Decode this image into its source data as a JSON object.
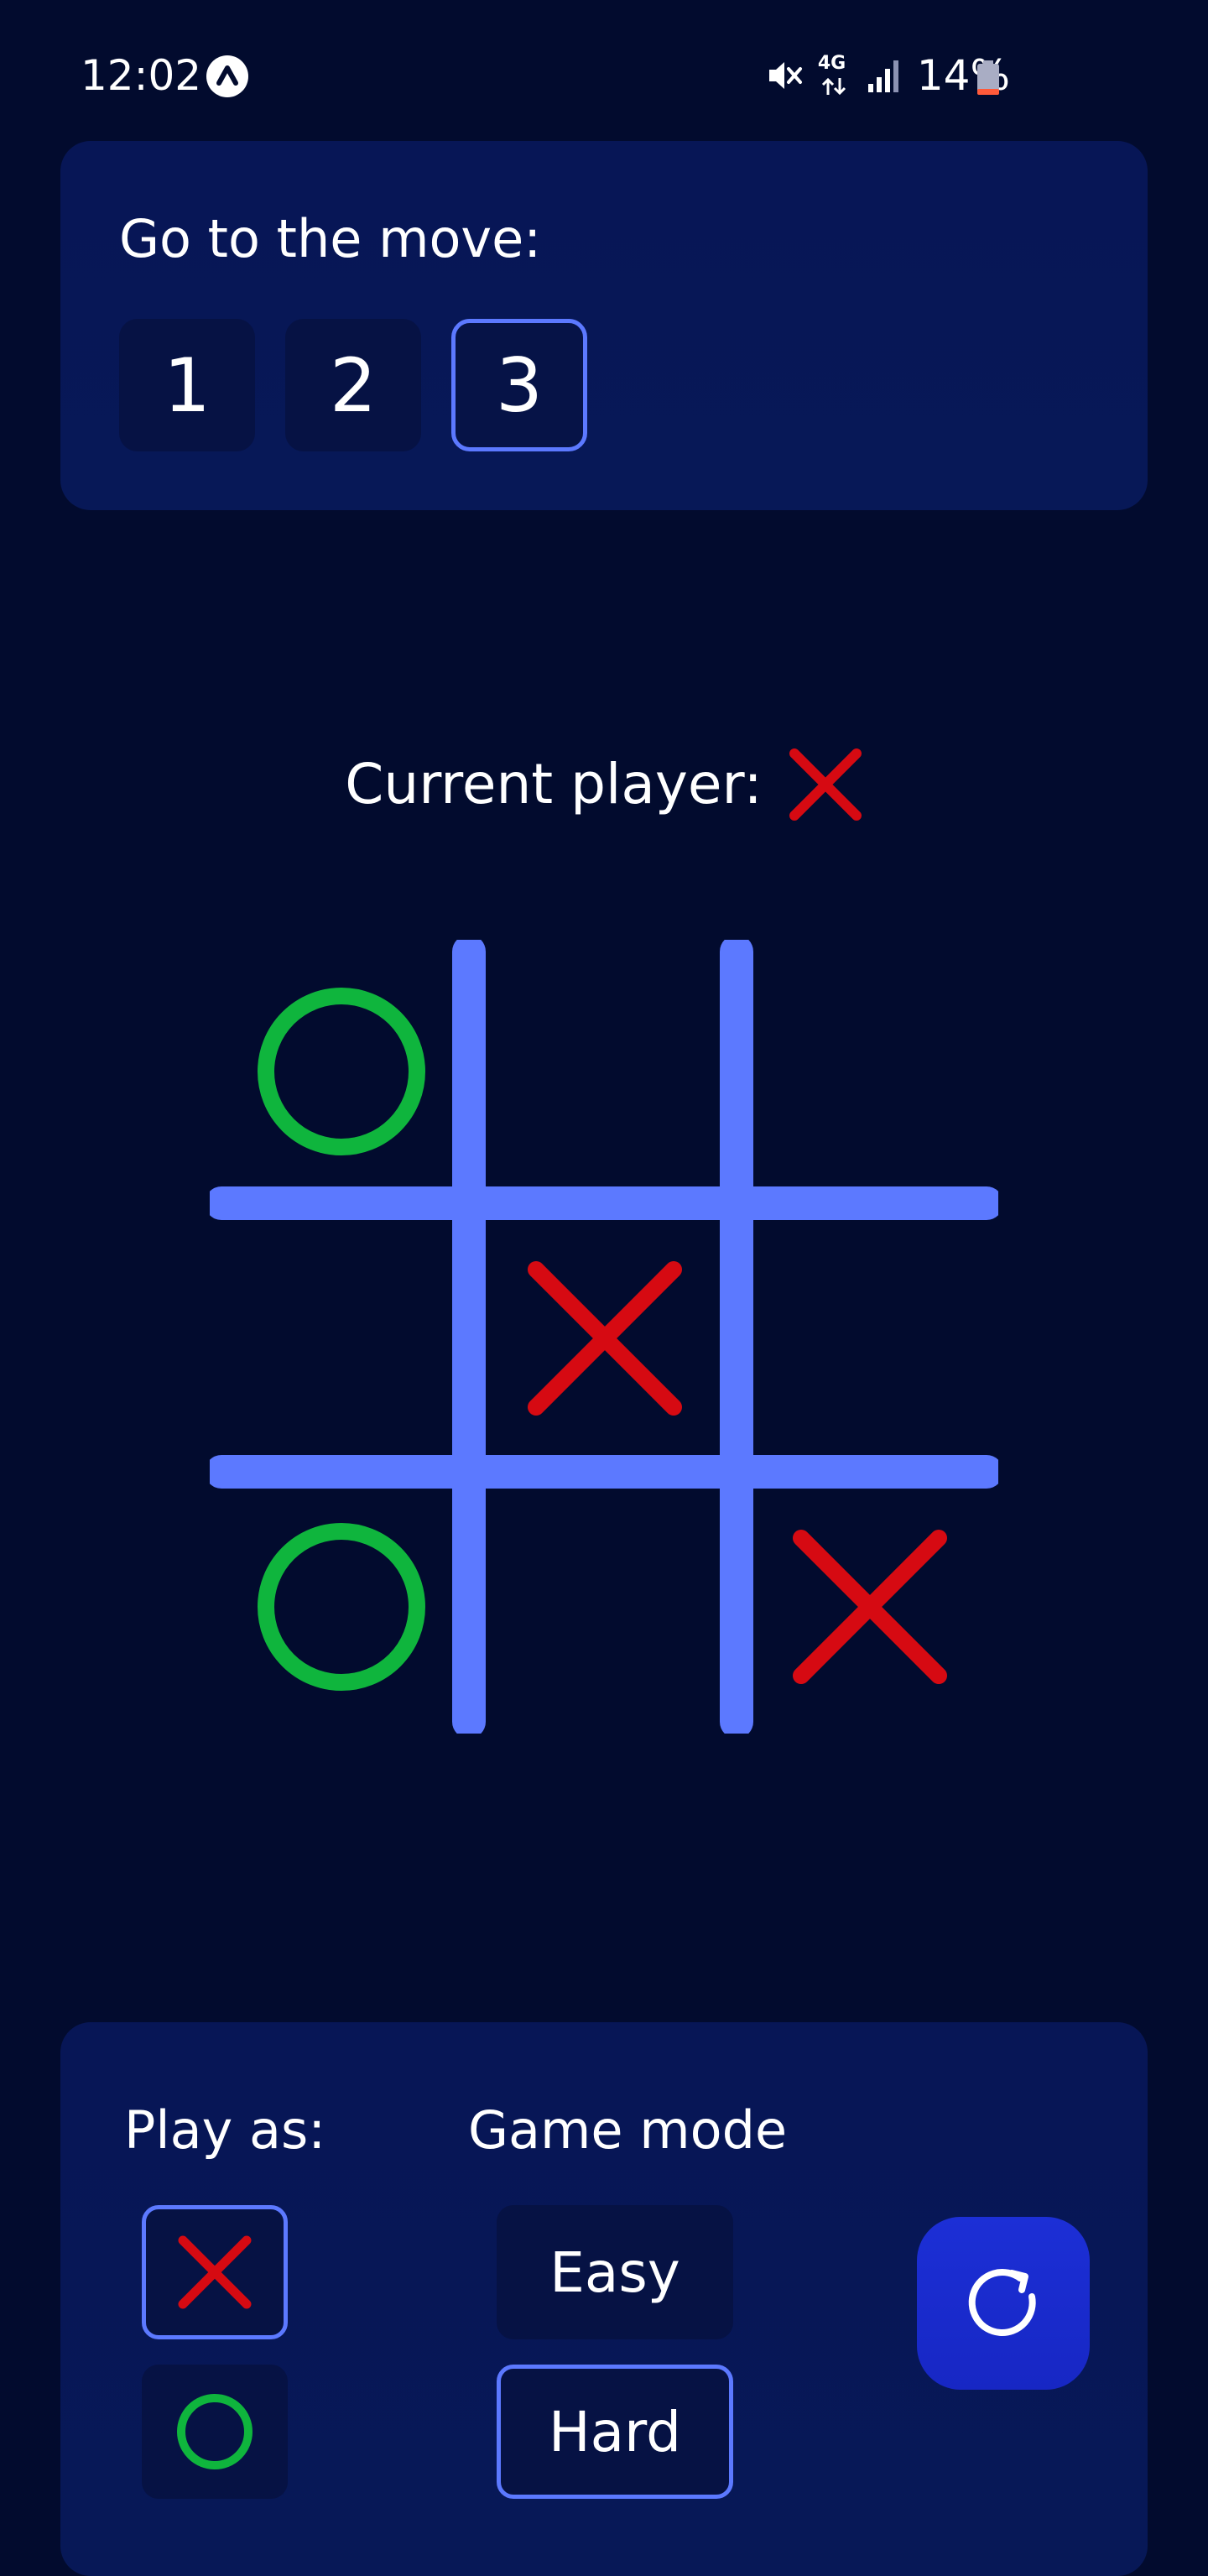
{
  "status_bar": {
    "time": "12:02",
    "network": "4G",
    "battery": "14%"
  },
  "move_history": {
    "title": "Go to the move:",
    "moves": [
      "1",
      "2",
      "3"
    ],
    "selected_index": 2
  },
  "current_player": {
    "label": "Current player:",
    "symbol": "X"
  },
  "board": {
    "cells": [
      "O",
      "",
      "",
      "",
      "X",
      "",
      "O",
      "",
      "X"
    ]
  },
  "settings": {
    "play_as_label": "Play as:",
    "game_mode_label": "Game mode",
    "play_as_options": [
      "X",
      "O"
    ],
    "play_as_selected": "X",
    "modes": [
      "Easy",
      "Hard"
    ],
    "mode_selected": "Hard"
  },
  "colors": {
    "background": "#020b2e",
    "panel": "#071656",
    "grid": "#5c79ff",
    "x_mark": "#d60a12",
    "o_mark": "#0fb53d",
    "accent_border": "#5c79ff",
    "restart_button": "#1c2fd6"
  }
}
